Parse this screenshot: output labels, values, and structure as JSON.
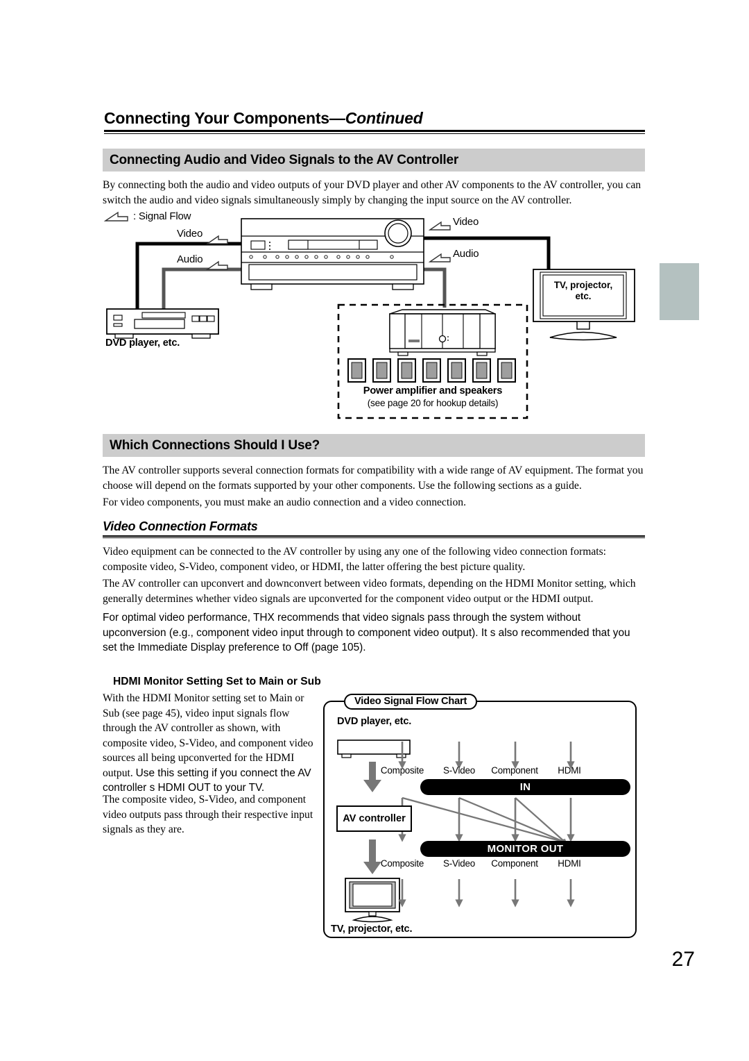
{
  "running_head": {
    "title": "Connecting Your Components",
    "continued": "—Continued"
  },
  "sections": [
    {
      "id": "connecting-av",
      "heading": "Connecting Audio and Video Signals to the AV Controller",
      "paragraphs": [
        "By connecting both the audio and video outputs of your DVD player and other AV components to the AV controller, you can switch the audio and video signals simultaneously simply by changing the input source on the AV controller."
      ]
    },
    {
      "id": "which-connections",
      "heading": "Which Connections Should I Use?",
      "paragraphs": [
        "The AV controller supports several connection formats for compatibility with a wide range of AV equipment. The format you choose will depend on the formats supported by your other components. Use the following sections as a guide.",
        "For video components, you must make an audio connection and a video connection."
      ]
    }
  ],
  "subsection": {
    "heading": "Video Connection Formats",
    "paragraphs": [
      "Video equipment can be connected to the AV controller by using any one of the following video connection formats: composite video, S-Video, component video, or HDMI, the latter offering the best picture quality.",
      "The AV controller can upconvert and downconvert between video formats, depending on the HDMI Monitor setting, which generally determines whether video signals are upconverted for the component video output or the HDMI output."
    ],
    "thx_paragraph": "For optimal video performance, THX recommends that video signals pass through the system without upconversion (e.g., component video input through to component video output). It s also recommended that you set the Immediate Display preference to Off (page 105)."
  },
  "hdmi_setting": {
    "heading": "HDMI Monitor Setting Set to Main or Sub",
    "paragraph_1_serif": "With the HDMI Monitor setting set to Main or Sub (see page 45), video input signals flow through the AV controller as shown, with composite video, S-Video, and component video sources all being upconverted for the HDMI output. ",
    "paragraph_1_sans": "Use this setting if you connect the AV controller s HDMI OUT to your TV.",
    "paragraph_2": "The composite video, S-Video, and component video outputs pass through their respective input signals as they are."
  },
  "connection_diagram": {
    "legend_label": ": Signal Flow",
    "left_video_label": "Video",
    "left_audio_label": "Audio",
    "right_video_label": "Video",
    "right_audio_label": "Audio",
    "dvd_label": "DVD player, etc.",
    "tv_label_line1": "TV, projector,",
    "tv_label_line2": "etc.",
    "amp_label": "Power amplifier and speakers",
    "amp_sublabel": "(see page 20 for hookup details)",
    "speaker_count": 7
  },
  "flow_chart": {
    "title": "Video Signal Flow Chart",
    "source_label": "DVD player, etc.",
    "controller_label": "AV controller",
    "sink_label": "TV, projector, etc.",
    "in_bar_label": "IN",
    "out_bar_label": "MONITOR OUT",
    "in_ports": [
      "Composite",
      "S-Video",
      "Component",
      "HDMI"
    ],
    "out_ports": [
      "Composite",
      "S-Video",
      "Component",
      "HDMI"
    ],
    "routes": [
      {
        "from": "Composite",
        "to": "Composite"
      },
      {
        "from": "Composite",
        "to": "HDMI"
      },
      {
        "from": "S-Video",
        "to": "S-Video"
      },
      {
        "from": "S-Video",
        "to": "HDMI"
      },
      {
        "from": "Component",
        "to": "Component"
      },
      {
        "from": "Component",
        "to": "HDMI"
      },
      {
        "from": "HDMI",
        "to": "HDMI"
      }
    ]
  },
  "page_number": "27",
  "colors": {
    "section_bar": "#cccccc",
    "thumb_tab": "#b4c1c0",
    "arrow_gray": "#777777",
    "audio_cable_gray": "#666666",
    "speaker_fill": "#9e9e9e"
  }
}
